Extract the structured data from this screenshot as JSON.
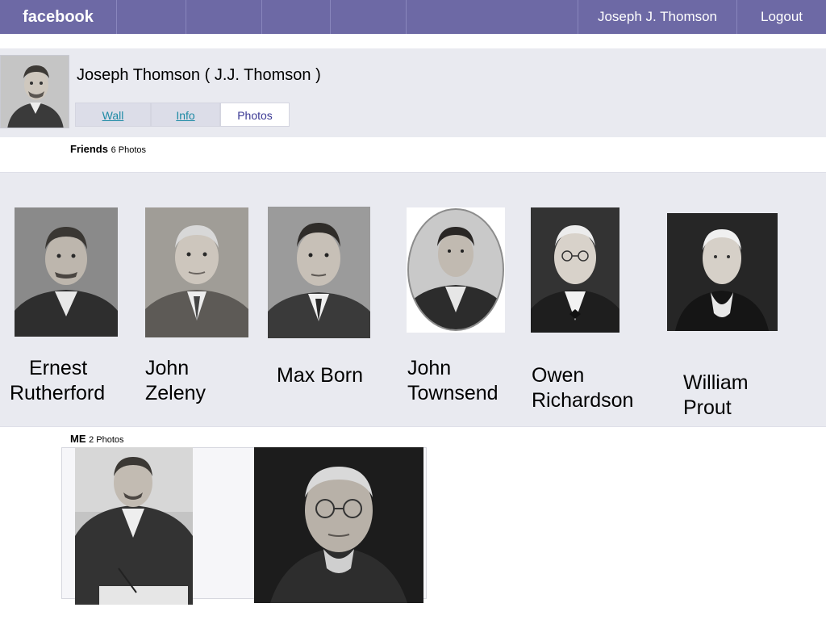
{
  "topbar": {
    "brand": "facebook",
    "user_name": "Joseph J. Thomson",
    "logout_label": "Logout",
    "background_color": "#6d69a5"
  },
  "profile": {
    "name": "Joseph Thomson ( J.J. Thomson )",
    "tabs": [
      {
        "label": "Wall",
        "active": false
      },
      {
        "label": "Info",
        "active": false
      },
      {
        "label": "Photos",
        "active": true
      }
    ]
  },
  "friends_section": {
    "title": "Friends",
    "count_label": "6 Photos",
    "friends": [
      {
        "name": "Ernest Rutherford",
        "line1": "Ernest",
        "line2": "Rutherford"
      },
      {
        "name": "John Zeleny",
        "line1": "John",
        "line2": "Zeleny"
      },
      {
        "name": "Max Born",
        "line1": "Max Born",
        "line2": ""
      },
      {
        "name": "John Townsend",
        "line1": "John",
        "line2": "Townsend"
      },
      {
        "name": "Owen Richardson",
        "line1": "Owen",
        "line2": "Richardson"
      },
      {
        "name": "William Prout",
        "line1": "William",
        "line2": "Prout"
      }
    ]
  },
  "me_section": {
    "title": "ME",
    "count_label": "2 Photos"
  },
  "colors": {
    "panel_background": "#e9eaf0",
    "link": "#1e8aa5",
    "active_tab_text": "#3b3994"
  }
}
